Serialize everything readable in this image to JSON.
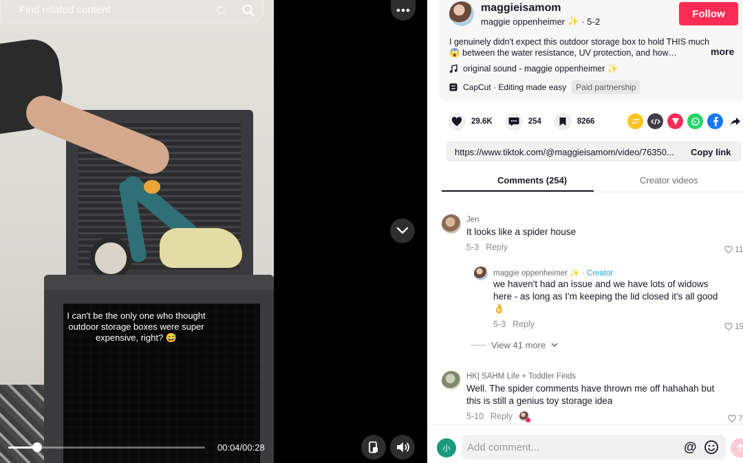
{
  "video": {
    "search_placeholder": "Find related content",
    "caption": "I can't be the only one who thought outdoor storage boxes were super expensive, right? 😅",
    "time": "00:04/00:28",
    "progress": 0.147
  },
  "post": {
    "username": "maggieisamom",
    "nickname": "maggie oppenheimer",
    "sparkle": "✨",
    "date": "· 5-2",
    "follow_label": "Follow",
    "description": "I genuinely didn't expect this outdoor storage box to hold THIS much 😱 between the water resistance, UV protection, and how…",
    "more_label": "more",
    "sound": "original sound - maggie oppenheimer ✨",
    "capcut": "CapCut · Editing made easy",
    "paid": "Paid partnership"
  },
  "stats": {
    "likes": "29.6K",
    "comments": "254",
    "saves": "8266"
  },
  "share_link": {
    "url": "https://www.tiktok.com/@maggieisamom/video/76350...",
    "copy_label": "Copy link"
  },
  "tabs": {
    "comments": "Comments (254)",
    "creator": "Creator videos"
  },
  "comments": [
    {
      "user": "Jen",
      "text": "It looks like a spider house",
      "date": "5-3",
      "reply": "Reply",
      "likes": "11"
    },
    {
      "user": "maggie oppenheimer ✨",
      "creator_tag": "· Creator",
      "text": "we haven't had an issue and we have lots of widows here - as long as I'm keeping the lid closed it's all good 👌",
      "date": "5-3",
      "reply": "Reply",
      "likes": "19"
    },
    {
      "user": "HK| SAHM Life + Toddler Finds",
      "text": "Well. The spider comments have thrown me off hahahah but this is still a genius toy storage idea",
      "date": "5-10",
      "reply": "Reply",
      "likes": "7"
    }
  ],
  "view_more": "View 41 more",
  "composer": {
    "avatar_text": "小",
    "placeholder": "Add comment...",
    "at": "@"
  },
  "colors": {
    "follow": "#fe2c55",
    "creator": "#1aa7ce"
  }
}
